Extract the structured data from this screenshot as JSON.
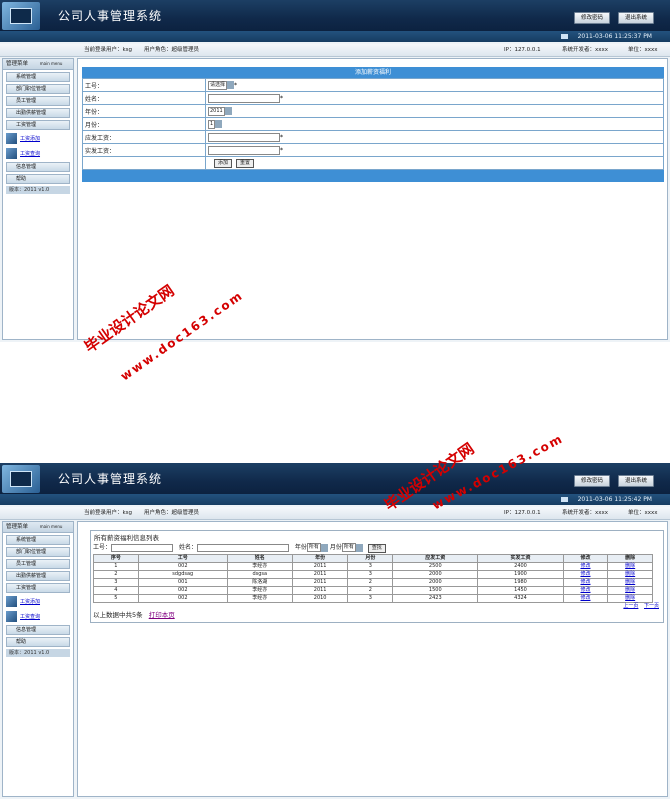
{
  "app": {
    "title": "公司人事管理系统",
    "change_password": "修改密码",
    "logout": "退出系统",
    "datetime_1": "2011-03-06 11:25:37 PM",
    "datetime_2": "2011-03-06 11:25:42 PM"
  },
  "info": {
    "current_user": "当前登录用户：ksg",
    "user_role": "用户角色：超级管理员",
    "ip": "IP：127.0.0.1",
    "developer": "系统开发者：xxxx",
    "unit": "单位：xxxx"
  },
  "sidebar": {
    "head": "管理菜单",
    "head_en": "main menu",
    "items": [
      "系统管理",
      "部门职位管理",
      "员工管理",
      "出勤供薪管理",
      "工资管理"
    ],
    "links": [
      "工资添加",
      "工资查询"
    ],
    "bottom_items": [
      "信息管理",
      "帮助"
    ],
    "version": "版本：2011 v1.0"
  },
  "form": {
    "title": "添加薪资福利",
    "labels": [
      "工号：",
      "姓名：",
      "年份：",
      "月份：",
      "应发工资：",
      "实发工资："
    ],
    "employee_select": "请选择",
    "year_value": "2011",
    "month_value": "1",
    "required_mark": "*",
    "add_button": "添加",
    "reset_button": "重置"
  },
  "list": {
    "title": "所有薪资福利信息列表",
    "search_labels": [
      "工号：",
      "姓名：",
      "年份",
      "月份"
    ],
    "year_option": "所有",
    "month_option": "所有",
    "search_button": "查找",
    "columns": [
      "序号",
      "工号",
      "姓名",
      "年份",
      "月份",
      "应发工资",
      "实发工资",
      "修改",
      "删除"
    ],
    "rows": [
      [
        "1",
        "002",
        "李经亦",
        "2011",
        "3",
        "2500",
        "2400",
        "修改",
        "删除"
      ],
      [
        "2",
        "sdgdsag",
        "dsgsa",
        "2011",
        "3",
        "2000",
        "1900",
        "修改",
        "删除"
      ],
      [
        "3",
        "001",
        "陈洛湖",
        "2011",
        "2",
        "2000",
        "1980",
        "修改",
        "删除"
      ],
      [
        "4",
        "002",
        "李经亦",
        "2011",
        "2",
        "1500",
        "1450",
        "修改",
        "删除"
      ],
      [
        "5",
        "002",
        "李经亦",
        "2010",
        "3",
        "2423",
        "4324",
        "修改",
        "删除"
      ]
    ],
    "prev_page": "上一页",
    "next_page": "下一页",
    "summary": "以上数据中共5条",
    "print": "打印本页"
  },
  "watermark": {
    "site_cn": "毕业设计论文网",
    "url": "www.doc163.com",
    "color": "#d40000"
  }
}
